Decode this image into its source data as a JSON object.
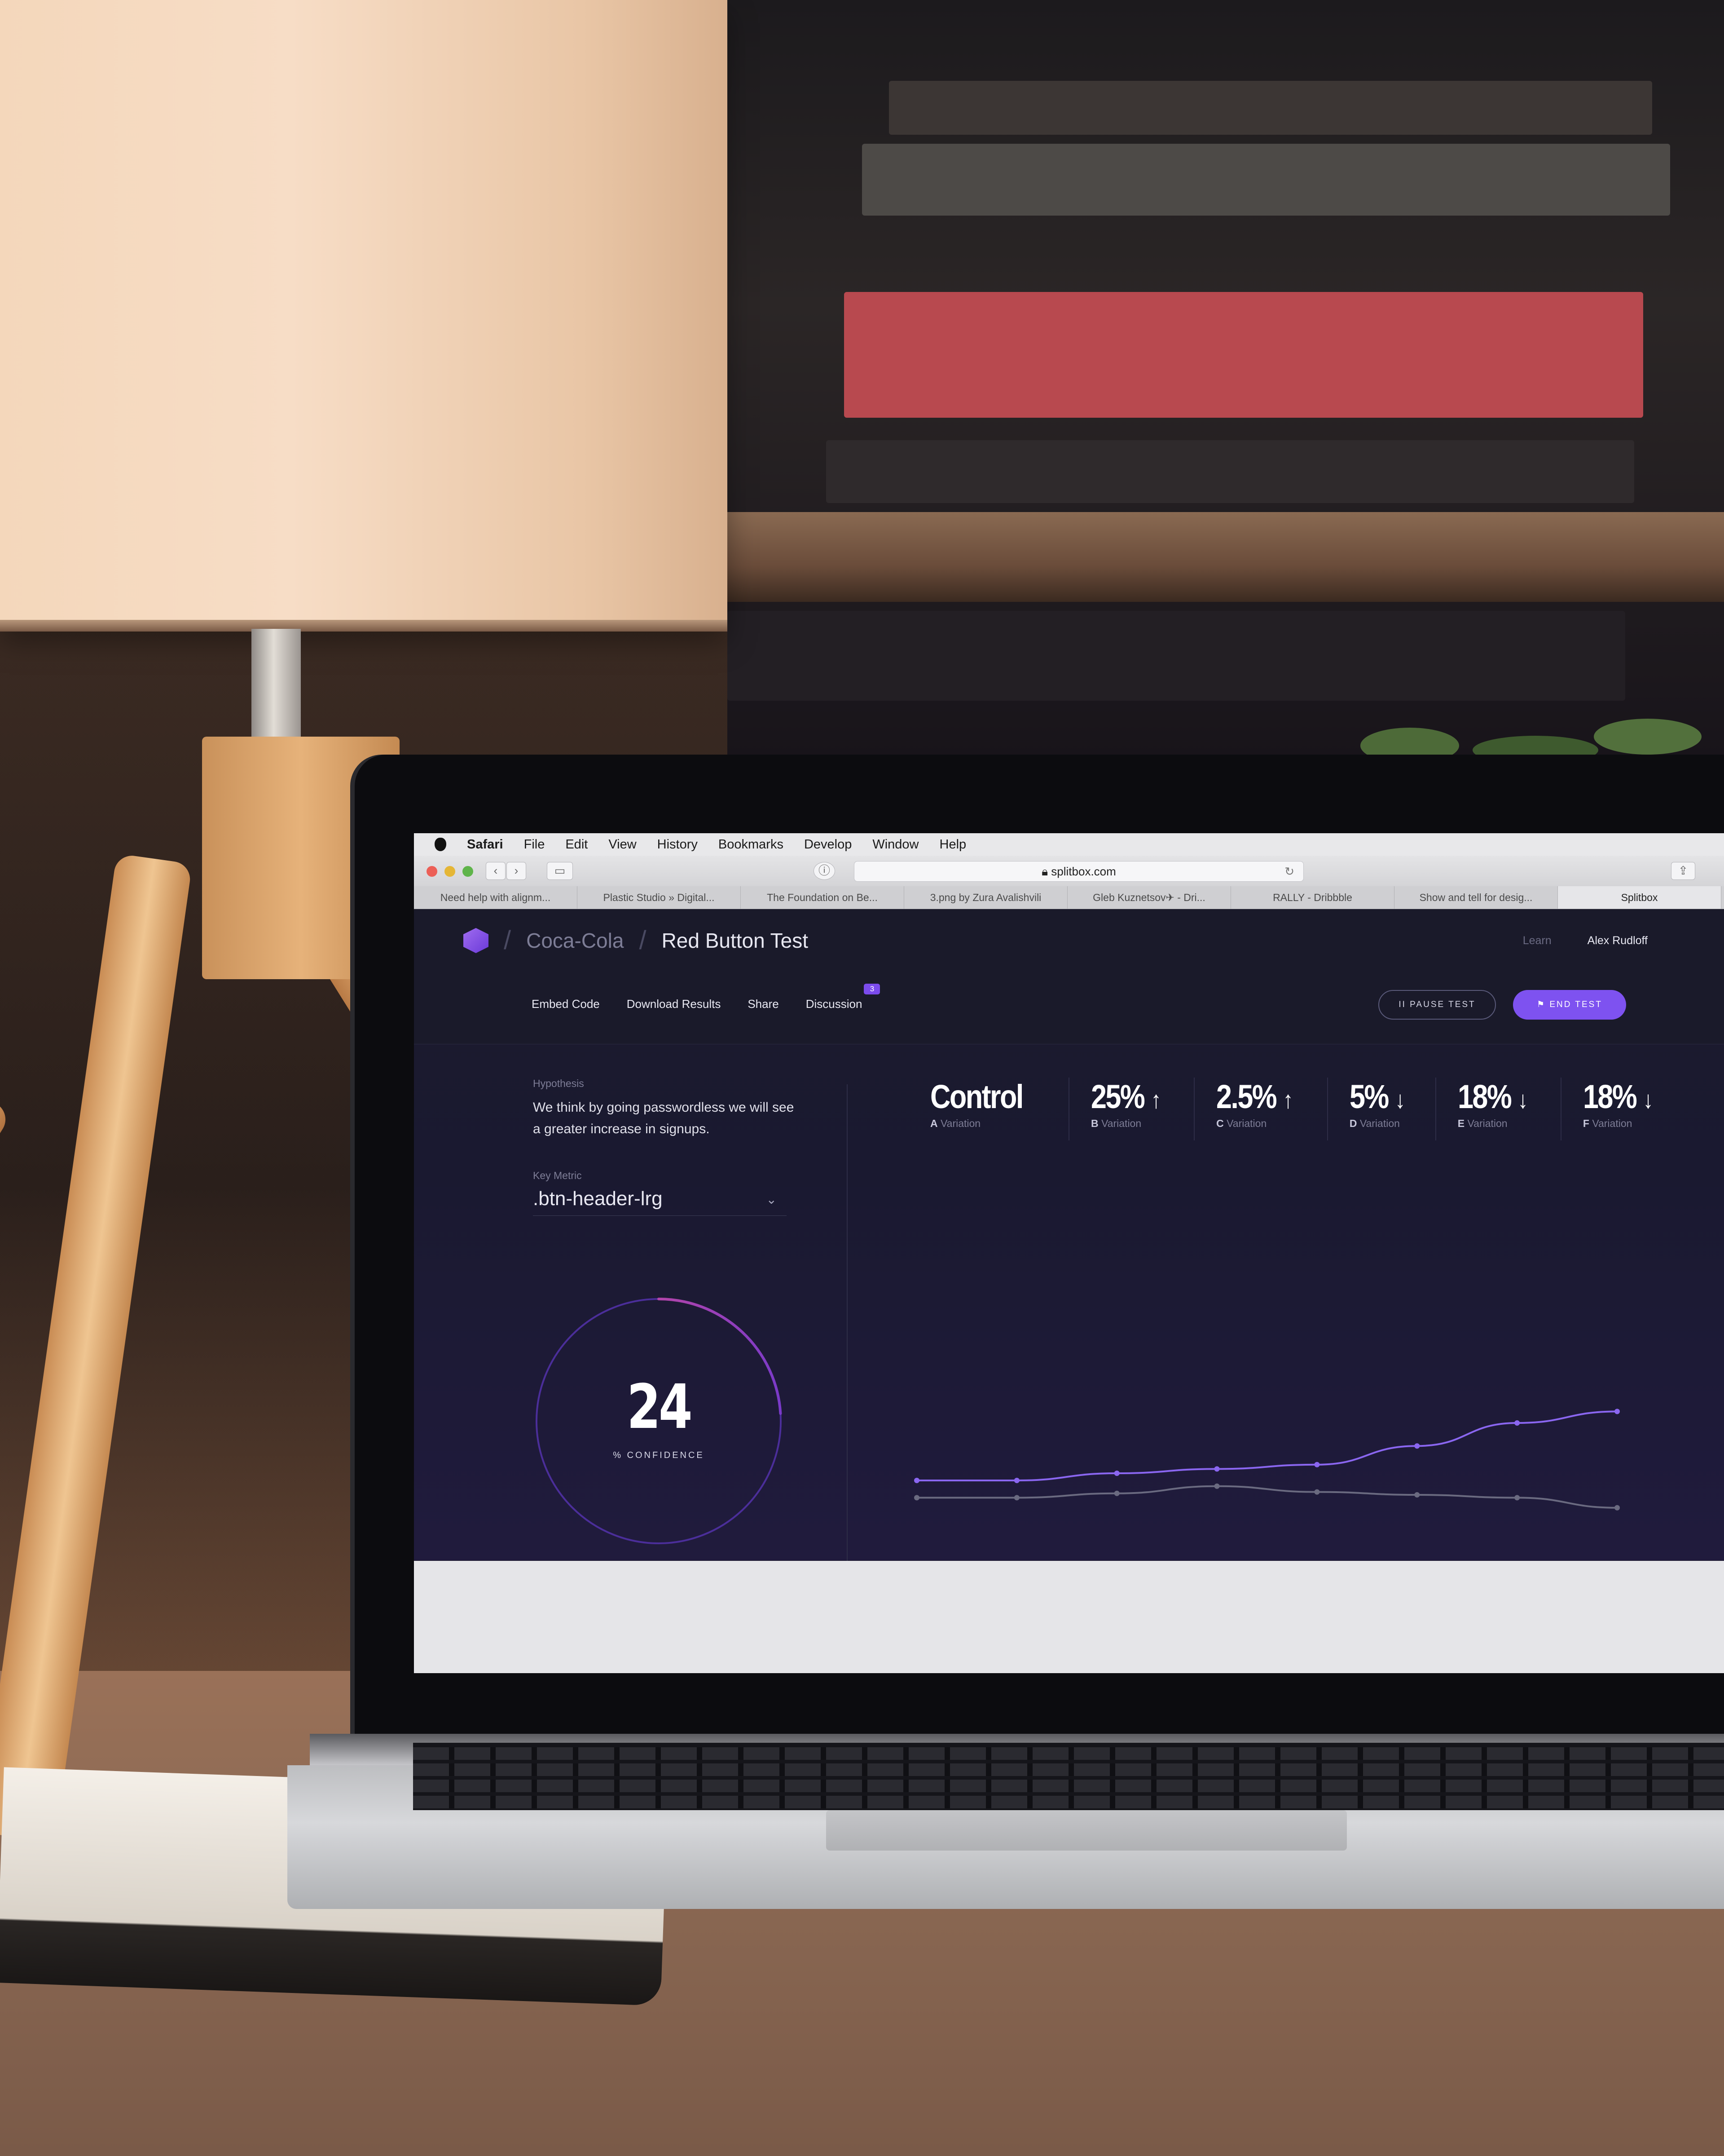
{
  "menubar": {
    "app": "Safari",
    "items": [
      "File",
      "Edit",
      "View",
      "History",
      "Bookmarks",
      "Develop",
      "Window",
      "Help"
    ]
  },
  "browser": {
    "url": "splitbox.com",
    "tabs": [
      "Need help with alignm...",
      "Plastic Studio » Digital...",
      "The Foundation on Be...",
      "3.png by Zura Avalishvili",
      "Gleb Kuznetsov✈ - Dri...",
      "RALLY - Dribbble",
      "Show and tell for desig...",
      "Splitbox"
    ]
  },
  "header": {
    "client": "Coca-Cola",
    "test_name": "Red Button Test",
    "learn": "Learn",
    "user": "Alex Rudloff"
  },
  "subnav": {
    "embed": "Embed Code",
    "download": "Download Results",
    "share": "Share",
    "discussion": "Discussion",
    "discussion_count": "3"
  },
  "actions": {
    "pause": "II PAUSE TEST",
    "end": "⚑ END TEST"
  },
  "hypothesis": {
    "label": "Hypothesis",
    "text": "We think by going passwordless we will see a greater increase in signups."
  },
  "key_metric": {
    "label": "Key Metric",
    "value": ".btn-header-lrg"
  },
  "confidence": {
    "value": "24",
    "label": "% CONFIDENCE",
    "fraction": 0.24
  },
  "variations": [
    {
      "value": "Control",
      "arrow": "",
      "letter": "A",
      "label": "Variation"
    },
    {
      "value": "25%",
      "arrow": "↑",
      "letter": "B",
      "label": "Variation"
    },
    {
      "value": "2.5%",
      "arrow": "↑",
      "letter": "C",
      "label": "Variation"
    },
    {
      "value": "5%",
      "arrow": "↓",
      "letter": "D",
      "label": "Variation"
    },
    {
      "value": "18%",
      "arrow": "↓",
      "letter": "E",
      "label": "Variation"
    },
    {
      "value": "18%",
      "arrow": "↓",
      "letter": "F",
      "label": "Variation"
    }
  ],
  "chart_data": {
    "type": "line",
    "x": [
      0,
      1,
      2,
      3,
      4,
      5,
      6,
      7
    ],
    "ylim": [
      0,
      100
    ],
    "series": [
      {
        "values": [
          40,
          40,
          45,
          48,
          51,
          64,
          80,
          88
        ],
        "color": "#8a66f0"
      },
      {
        "values": [
          28,
          28,
          31,
          36,
          32,
          30,
          28,
          21
        ],
        "color": "#6a6a80"
      }
    ]
  },
  "colors": {
    "accent": "#7e52f0",
    "app_bg": "#1b1a2b",
    "gauge_start": "#ec4f8c",
    "gauge_end": "#4b2e9a"
  }
}
